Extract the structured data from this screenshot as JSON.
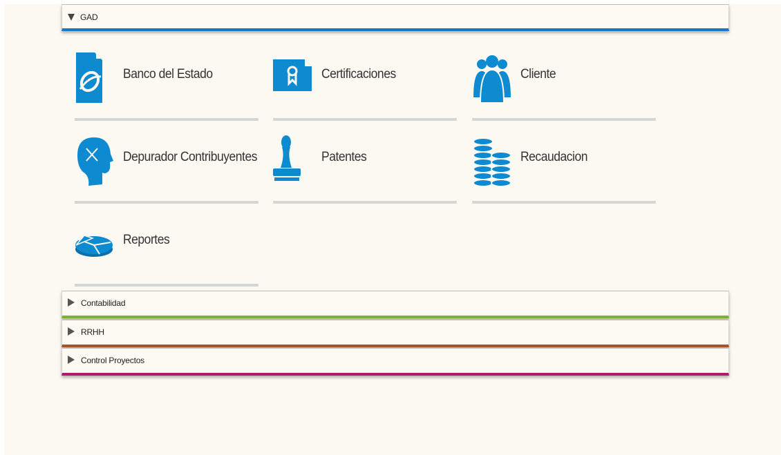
{
  "colors": {
    "page_bg": "#fcf8f2",
    "icon_blue": "#0e8ad1",
    "gad_accent": "#1f75bb",
    "contabilidad_accent": "#7cb23a",
    "rrhh_accent": "#a1562b",
    "control_accent": "#b2196e",
    "tile_divider": "#d5d5d5"
  },
  "sections": {
    "gad": {
      "label": "GAD",
      "expanded": true,
      "tiles": [
        {
          "label": "Banco del Estado",
          "icon": "bank-document-icon"
        },
        {
          "label": "Certificaciones",
          "icon": "certificate-ribbon-icon"
        },
        {
          "label": "Cliente",
          "icon": "people-group-icon"
        },
        {
          "label": "Depurador Contribuyentes",
          "icon": "head-x-icon"
        },
        {
          "label": "Patentes",
          "icon": "stamp-icon"
        },
        {
          "label": "Recaudacion",
          "icon": "coin-stacks-icon"
        },
        {
          "label": "Reportes",
          "icon": "pie-chart-icon"
        }
      ]
    },
    "contabilidad": {
      "label": "Contabilidad",
      "expanded": false
    },
    "rrhh": {
      "label": "RRHH",
      "expanded": false
    },
    "control_proyectos": {
      "label": "Control Proyectos",
      "expanded": false
    }
  }
}
